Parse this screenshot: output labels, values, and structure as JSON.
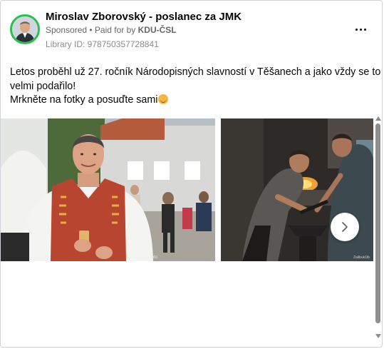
{
  "post": {
    "page_name": "Miroslav Zborovský - poslanec za JMK",
    "sponsored_label": "Sponsored",
    "paid_for_prefix": "Paid for by",
    "payer": "KDU-ČSL",
    "library_id": "Library ID: 978750357728841",
    "text_lines": [
      "Letos proběhl už 27. ročník Národopisných slavností v Těšanech a jako vždy se to",
      "velmi podařilo!",
      "Mrkněte na fotky a posuďte sami"
    ],
    "photo_credit": "Zalibuk1tb"
  },
  "icons": {
    "more": "more-horizontal-icon",
    "next": "chevron-right-icon",
    "emoji": "smiling-face-emoji"
  },
  "colors": {
    "avatar_ring": "#27c24c",
    "text": "#050505",
    "secondary": "#65676b"
  }
}
